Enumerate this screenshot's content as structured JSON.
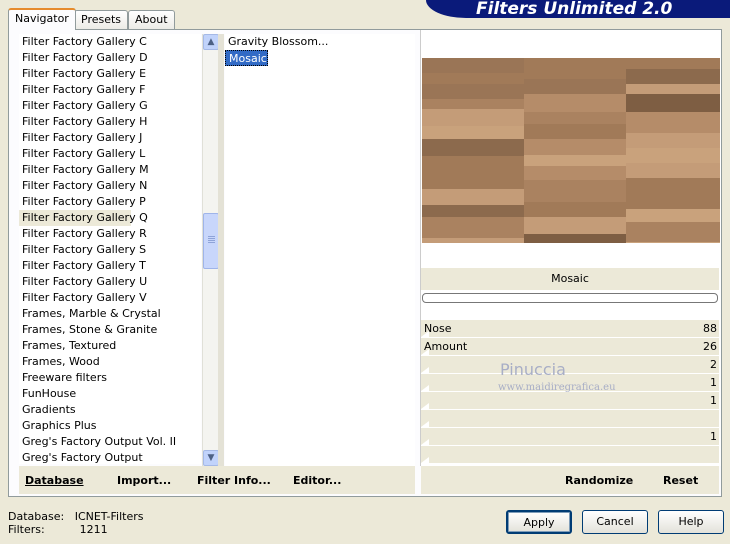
{
  "tabs": [
    "Navigator",
    "Presets",
    "About"
  ],
  "banner": "Filters Unlimited 2.0",
  "categories": [
    "Filter Factory Gallery C",
    "Filter Factory Gallery D",
    "Filter Factory Gallery E",
    "Filter Factory Gallery F",
    "Filter Factory Gallery G",
    "Filter Factory Gallery H",
    "Filter Factory Gallery J",
    "Filter Factory Gallery L",
    "Filter Factory Gallery M",
    "Filter Factory Gallery N",
    "Filter Factory Gallery P",
    "Filter Factory Gallery Q",
    "Filter Factory Gallery R",
    "Filter Factory Gallery S",
    "Filter Factory Gallery T",
    "Filter Factory Gallery U",
    "Filter Factory Gallery V",
    "Frames, Marble & Crystal",
    "Frames, Stone & Granite",
    "Frames, Textured",
    "Frames, Wood",
    "Freeware filters",
    "FunHouse",
    "Gradients",
    "Graphics Plus",
    "Greg's Factory Output Vol. II",
    "Greg's Factory Output"
  ],
  "selected_category": "Filter Factory Gallery Q",
  "filters": [
    "Gravity Blossom...",
    "Mosaic"
  ],
  "selected_filter": "Mosaic",
  "filter_name": "Mosaic",
  "params": [
    {
      "label": "Nose",
      "value": "88"
    },
    {
      "label": "Amount",
      "value": "26"
    },
    {
      "label": "",
      "value": "2"
    },
    {
      "label": "",
      "value": "1"
    },
    {
      "label": "",
      "value": "1"
    },
    {
      "label": "",
      "value": ""
    },
    {
      "label": "",
      "value": "1"
    },
    {
      "label": "",
      "value": ""
    }
  ],
  "left_buttons": {
    "database": "Database",
    "import": "Import...",
    "filter_info": "Filter Info...",
    "editor": "Editor..."
  },
  "right_buttons": {
    "randomize": "Randomize",
    "reset": "Reset"
  },
  "status": {
    "database_label": "Database:",
    "database_value": "ICNET-Filters",
    "filters_label": "Filters:",
    "filters_value": "1211"
  },
  "dialog_buttons": {
    "apply": "Apply",
    "cancel": "Cancel",
    "help": "Help"
  },
  "watermark": {
    "line1": "Pinuccia",
    "line2": "www.maidiregrafica.eu"
  }
}
